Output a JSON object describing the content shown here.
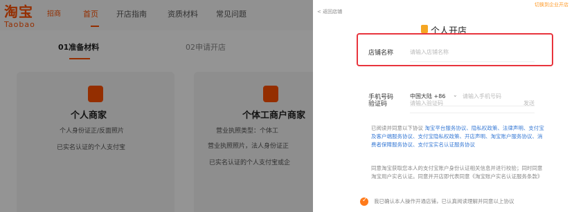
{
  "site": {
    "logo_cn": "淘宝",
    "logo_en": "Taobao",
    "logo_tag": "招商"
  },
  "nav": {
    "items": [
      {
        "label": "首页",
        "active": true
      },
      {
        "label": "开店指南",
        "active": false
      },
      {
        "label": "资质材料",
        "active": false
      },
      {
        "label": "常见问题",
        "active": false
      }
    ]
  },
  "steps": [
    {
      "label": "01准备材料",
      "active": true
    },
    {
      "label": "02申请开店",
      "active": false
    }
  ],
  "cards": [
    {
      "title": "个人商家",
      "lines": [
        "个人身份证正/反面照片",
        "已实名认证的个人支付宝"
      ]
    },
    {
      "title": "个体工商户商家",
      "lines": [
        "营业执照类型：个体工",
        "营业执照照片，法人身份证正",
        "已实名认证的个人支付宝或企"
      ]
    }
  ],
  "drawer": {
    "back_link": "< 返回店铺",
    "top_right_link": "切换到企业开店",
    "title": "个人开店",
    "fields": {
      "store_name": {
        "label": "店铺名称",
        "placeholder": "请输入店铺名称"
      },
      "phone": {
        "label": "手机号码",
        "region": "中国大陆 +86",
        "placeholder": "请输入手机号码"
      },
      "code": {
        "label": "验证码",
        "placeholder": "请输入验证码",
        "send": "发送"
      }
    },
    "agreement_prefix": "已阅读并同意以下协议",
    "agreement_links": "淘宝平台服务协议、隐私权政策、法律声明、支付宝及客户端服务协议、支付宝隐私权政策、开店声明、淘宝账户服务协议、消费者保障服务协议、支付宝实名认证服务协议",
    "agreement2": "同意淘宝获取您本人的支付宝账户身份认证相关信息并进行校验；同时同意淘宝用户实名认证。同意并开店即代表同意《淘宝账户实名认证服务条款》",
    "agreement2_link": "《淘宝账户实名认证服务条款》",
    "confirm_text": "我已确认本人操作开通店铺，已认真阅读理解并同意以上协议"
  },
  "colors": {
    "brand": "#ff5000",
    "highlight": "#e8333c",
    "link": "#3a7bd5"
  }
}
